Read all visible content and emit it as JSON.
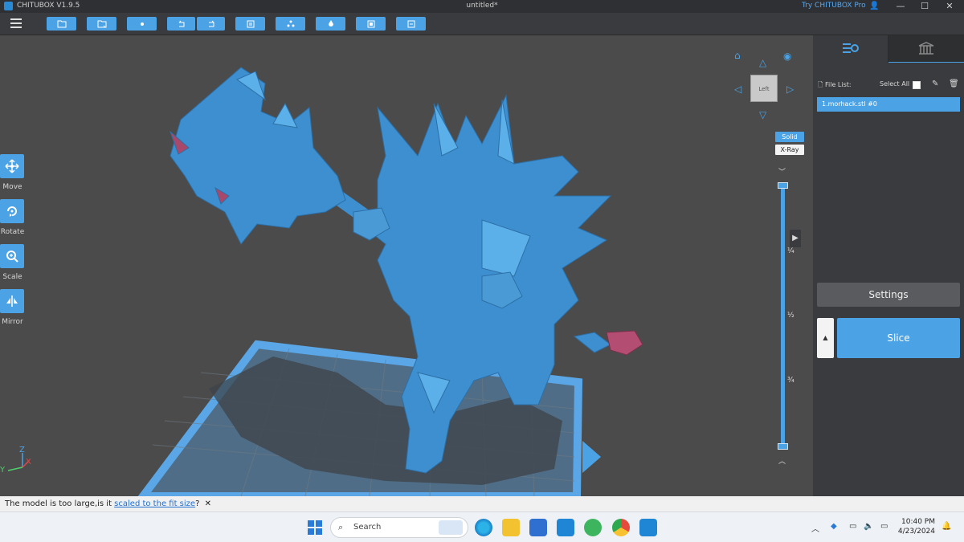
{
  "window": {
    "app_name": "CHITUBOX V1.9.5",
    "doc_title": "untitled*",
    "try_pro": "Try CHITUBOX Pro",
    "minimize": "—",
    "maximize": "☐",
    "close": "✕"
  },
  "toolbar": {
    "buttons": [
      "open-file-icon",
      "save-icon",
      "dot-icon",
      "undo-icon",
      "redo-icon",
      "layout-icon",
      "arrange-icon",
      "hollow-icon",
      "support-icon",
      "preview-icon"
    ]
  },
  "tools": [
    {
      "label": "Move"
    },
    {
      "label": "Rotate"
    },
    {
      "label": "Scale"
    },
    {
      "label": "Mirror"
    }
  ],
  "view": {
    "cube_face": "Left",
    "solid": "Solid",
    "xray": "X-Ray",
    "marks": [
      "¼",
      "½",
      "¾"
    ],
    "axes": {
      "x": "X",
      "y": "Y",
      "z": "Z"
    }
  },
  "panel": {
    "file_list_label": "File List:",
    "select_all_label": "Select All",
    "file_item": "1.morhack.stl #0",
    "settings_label": "Settings",
    "slice_label": "Slice",
    "slice_mini": "▲"
  },
  "status": {
    "message": "The model is too large,is it ",
    "link": "scaled to the fit size",
    "suffix": "?",
    "close": "✕"
  },
  "taskbar": {
    "search_placeholder": "Search",
    "time": "10:40 PM",
    "date": "4/23/2024"
  },
  "colors": {
    "accent": "#4ba3e6",
    "panel": "#3a3b3e",
    "viewport": "#4b4b4b",
    "model": "#3d8fd0",
    "plate": "#5aa6e6"
  }
}
